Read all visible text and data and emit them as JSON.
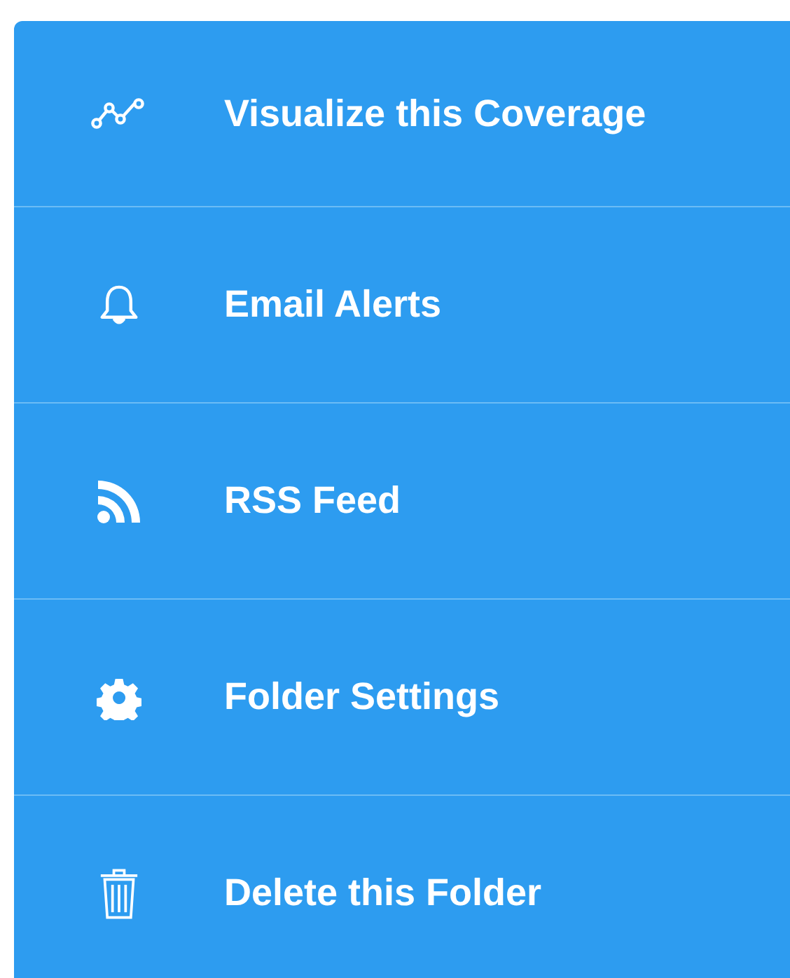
{
  "menu": {
    "items": [
      {
        "kind": "chart",
        "label": "Visualize this Coverage"
      },
      {
        "kind": "bell",
        "label": "Email Alerts"
      },
      {
        "kind": "rss",
        "label": "RSS Feed"
      },
      {
        "kind": "gear",
        "label": "Folder Settings"
      },
      {
        "kind": "trash",
        "label": "Delete this Folder"
      }
    ]
  }
}
